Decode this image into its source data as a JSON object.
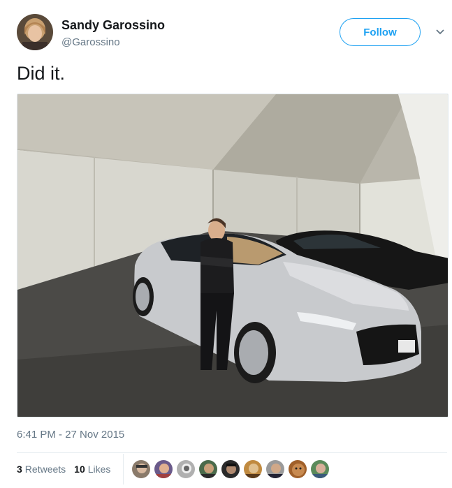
{
  "user": {
    "name": "Sandy Garossino",
    "handle": "@Garossino"
  },
  "follow_label": "Follow",
  "tweet": {
    "text": "Did it."
  },
  "timestamp": "6:41 PM - 27 Nov 2015",
  "stats": {
    "retweets_count": "3",
    "retweets_label": "Retweets",
    "likes_count": "10",
    "likes_label": "Likes"
  },
  "colors": {
    "accent": "#1da1f2",
    "secondary_text": "#657786",
    "primary_text": "#14171a"
  }
}
